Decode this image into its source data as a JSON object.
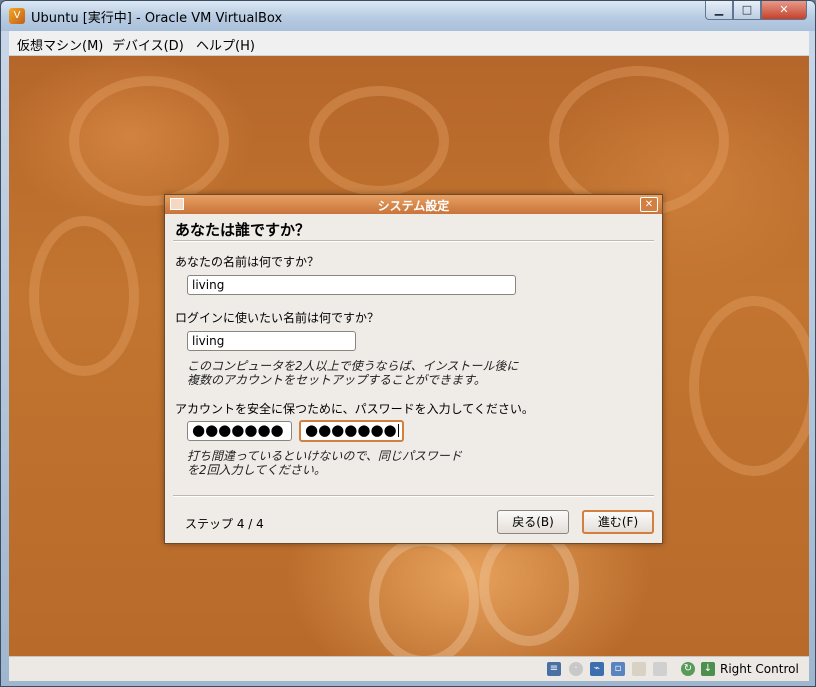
{
  "window": {
    "title": "Ubuntu [実行中] - Oracle VM VirtualBox",
    "controls": {
      "minimize": "▁",
      "maximize": "□",
      "close": "✕"
    }
  },
  "menubar": {
    "items": [
      "仮想マシン(M)",
      "デバイス(D)",
      "ヘルプ(H)"
    ]
  },
  "dialog": {
    "title": "システム設定",
    "heading": "あなたは誰ですか？",
    "name_label": "あなたの名前は何ですか？",
    "name_value": "living",
    "login_label": "ログインに使いたい名前は何ですか？",
    "login_value": "living",
    "login_hint": "このコンピュータを2人以上で使うならば、インストール後に\n複数のアカウントをセットアップすることができます。",
    "password_label": "アカウントを安全に保つために、パスワードを入力してください。",
    "password_value": "●●●●●●●",
    "password_confirm_value": "●●●●●●●",
    "password_hint": "打ち間違っているといけないので、同じパスワード\nを2回入力してください。",
    "step": "ステップ 4 / 4",
    "back_button": "戻る(B)",
    "forward_button": "進む(F)"
  },
  "statusbar": {
    "host_key": "Right Control",
    "icons": [
      "hard-disk-icon",
      "optical-drive-icon",
      "usb-icon",
      "network-icon",
      "shared-folders-icon",
      "display-icon",
      "mouse-integration-icon",
      "host-key-icon"
    ]
  },
  "colors": {
    "accent": "#d27f42",
    "guest_background": "#b86a2b",
    "dialog_background": "#efebe7"
  }
}
